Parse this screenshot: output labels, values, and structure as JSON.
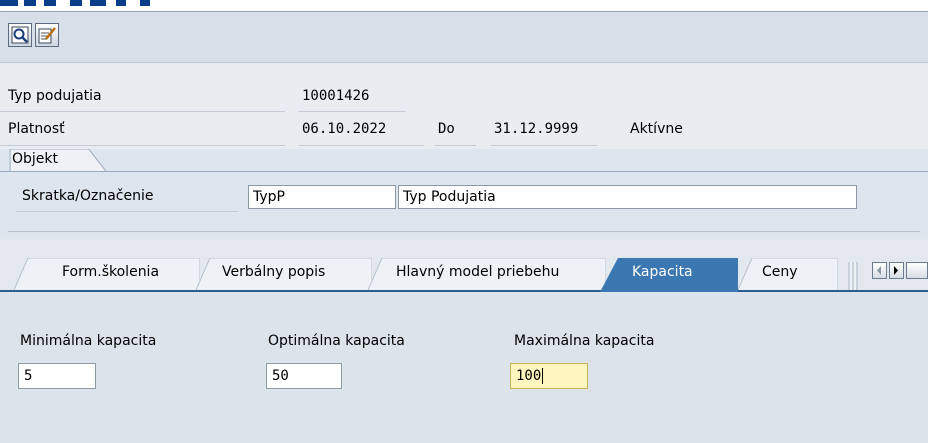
{
  "header": {
    "fields": [
      {
        "label": "Typ podujatia",
        "value": "10001426"
      },
      {
        "label": "Platnosť",
        "from": "06.10.2022",
        "to_label": "Do",
        "to": "31.12.9999",
        "status": "Aktívne"
      }
    ]
  },
  "object_group": {
    "title": "Objekt",
    "label": "Skratka/Označenie",
    "short": "TypP",
    "name": "Typ Podujatia"
  },
  "tabs": [
    {
      "label": "Form.školenia",
      "active": false
    },
    {
      "label": "Verbálny popis",
      "active": false
    },
    {
      "label": "Hlavný model priebehu",
      "active": false
    },
    {
      "label": "Kapacita",
      "active": true
    },
    {
      "label": "Ceny",
      "active": false
    }
  ],
  "capacity": {
    "min_label": "Minimálna kapacita",
    "min_value": "5",
    "opt_label": "Optimálna kapacita",
    "opt_value": "50",
    "max_label": "Maximálna kapacita",
    "max_value": "100"
  },
  "icons": [
    "display-icon",
    "change-icon",
    "tab-scroll-left-icon",
    "tab-scroll-right-icon"
  ],
  "colors": {
    "active_tab": "#3b77b0",
    "focus_field": "#fff5bf"
  }
}
